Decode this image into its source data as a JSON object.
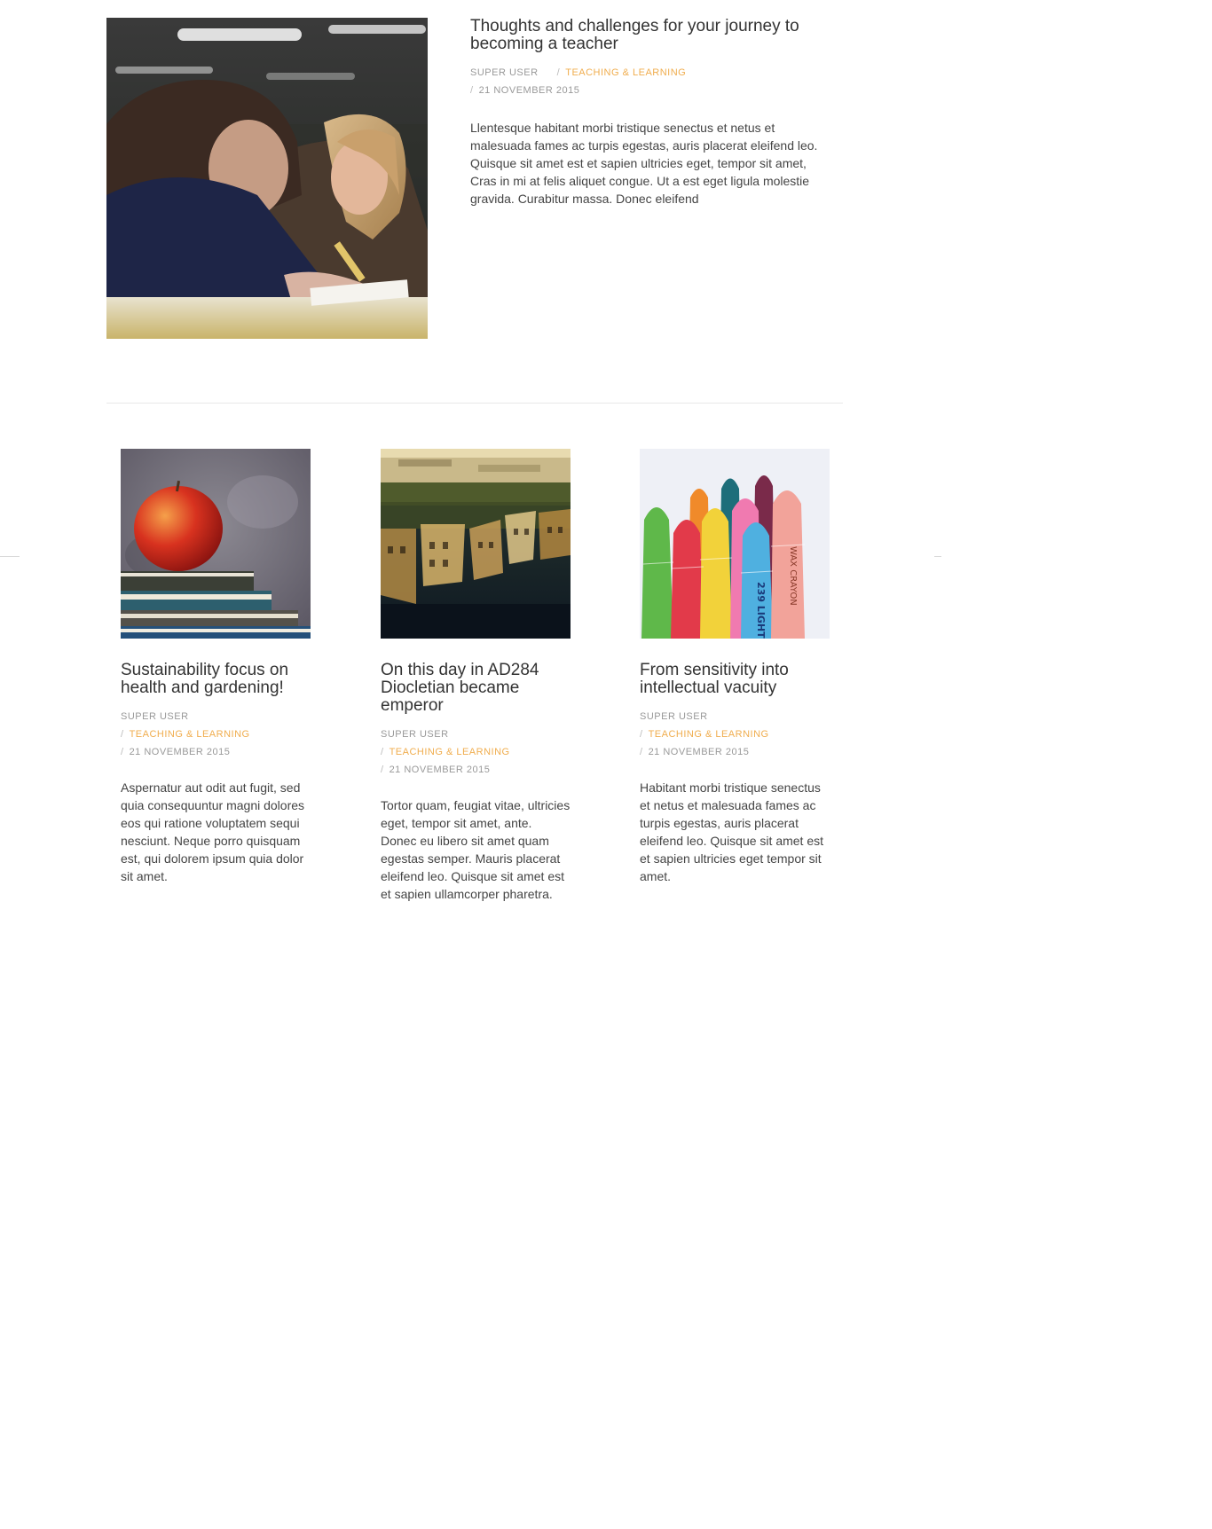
{
  "featured": {
    "title": "Thoughts and challenges for your journey to becoming a teacher",
    "author": "SUPER USER",
    "category": "TEACHING & LEARNING",
    "date": "21 NOVEMBER 2015",
    "intro": "Llentesque habitant morbi tristique senectus et netus et malesuada fames ac turpis egestas, auris placerat eleifend leo. Quisque sit amet est et sapien ultricies eget, tempor sit amet, Cras in mi at felis aliquet congue. Ut a est eget ligula molestie gravida. Curabitur massa. Donec eleifend"
  },
  "meta_separator": "/",
  "articles": [
    {
      "title": "Sustainability focus on health and gardening!",
      "author": "SUPER USER",
      "category": "TEACHING & LEARNING",
      "date": "21 NOVEMBER 2015",
      "intro": "Aspernatur aut odit aut fugit, sed quia consequuntur magni dolores eos qui ratione voluptatem sequi nesciunt. Neque porro quisquam est, qui dolorem ipsum quia dolor sit amet."
    },
    {
      "title": "On this day in AD284 Diocletian became emperor",
      "author": "SUPER USER",
      "category": "TEACHING & LEARNING",
      "date": "21 NOVEMBER 2015",
      "intro": "Tortor quam, feugiat vitae, ultricies eget, tempor sit amet, ante. Donec eu libero sit amet quam egestas semper. Mauris placerat eleifend leo. Quisque sit amet est et sapien ullamcorper pharetra."
    },
    {
      "title": "From sensitivity into intellectual vacuity",
      "author": "SUPER USER",
      "category": "TEACHING & LEARNING",
      "date": "21 NOVEMBER 2015",
      "intro": "Habitant morbi tristique senectus et netus et malesuada fames ac turpis egestas, auris placerat eleifend leo. Quisque sit amet est et sapien ultricies eget tempor sit amet."
    }
  ],
  "crayon_labels": {
    "label_a": "WAX CRAYON",
    "label_b": "239 LIGHT"
  },
  "colors": {
    "accent": "#f0ad4e",
    "meta": "#999999",
    "text": "#444444",
    "title": "#333333",
    "divider": "#e8e8e8"
  }
}
